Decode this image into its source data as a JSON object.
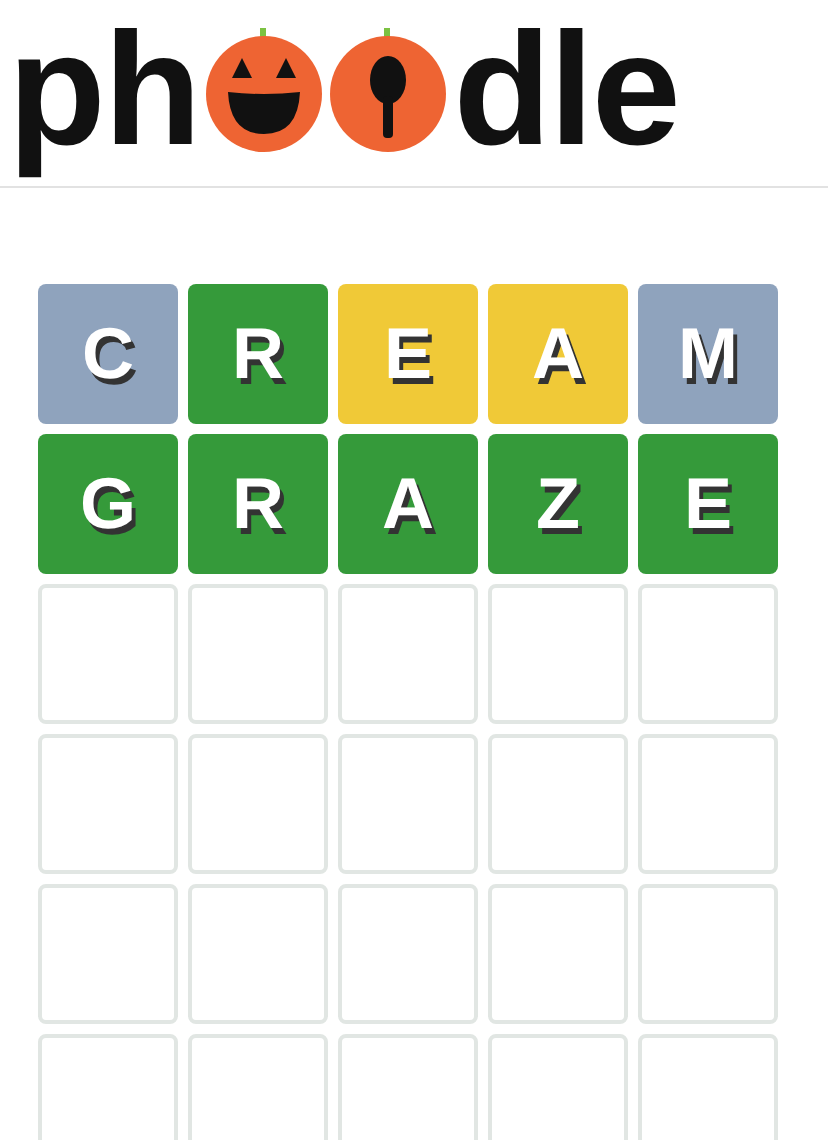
{
  "logo": {
    "before": "ph",
    "after": "dle"
  },
  "board": {
    "rows": [
      {
        "tiles": [
          {
            "letter": "C",
            "kind": "absent"
          },
          {
            "letter": "R",
            "kind": "correct"
          },
          {
            "letter": "E",
            "kind": "present"
          },
          {
            "letter": "A",
            "kind": "present"
          },
          {
            "letter": "M",
            "kind": "absent"
          }
        ]
      },
      {
        "tiles": [
          {
            "letter": "G",
            "kind": "correct"
          },
          {
            "letter": "R",
            "kind": "correct"
          },
          {
            "letter": "A",
            "kind": "correct"
          },
          {
            "letter": "Z",
            "kind": "correct"
          },
          {
            "letter": "E",
            "kind": "correct"
          }
        ]
      },
      {
        "tiles": [
          {
            "kind": "empty"
          },
          {
            "kind": "empty"
          },
          {
            "kind": "empty"
          },
          {
            "kind": "empty"
          },
          {
            "kind": "empty"
          }
        ]
      },
      {
        "tiles": [
          {
            "kind": "empty"
          },
          {
            "kind": "empty"
          },
          {
            "kind": "empty"
          },
          {
            "kind": "empty"
          },
          {
            "kind": "empty"
          }
        ]
      },
      {
        "tiles": [
          {
            "kind": "empty"
          },
          {
            "kind": "empty"
          },
          {
            "kind": "empty"
          },
          {
            "kind": "empty"
          },
          {
            "kind": "empty"
          }
        ]
      },
      {
        "tiles": [
          {
            "kind": "empty"
          },
          {
            "kind": "empty"
          },
          {
            "kind": "empty"
          },
          {
            "kind": "empty"
          },
          {
            "kind": "empty"
          }
        ]
      }
    ]
  }
}
